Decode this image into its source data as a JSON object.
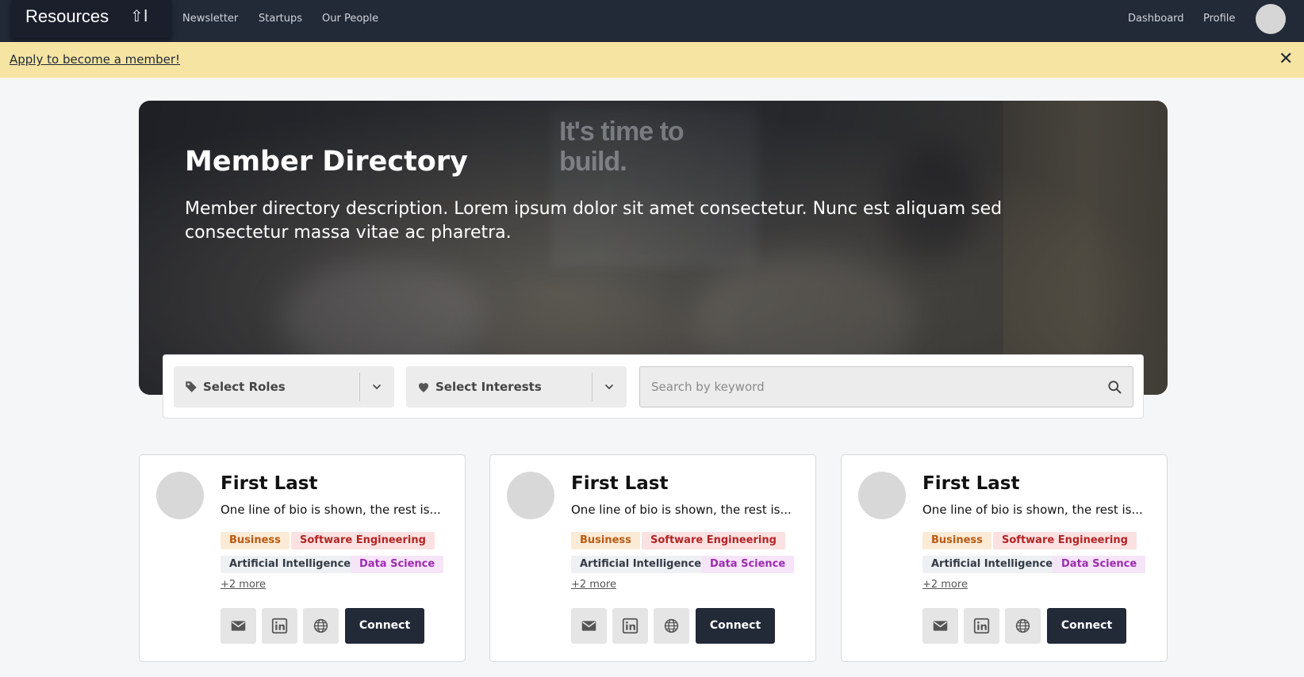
{
  "nav": {
    "brand": "Resources",
    "brand_glyph": "⇧I",
    "links": [
      "Newsletter",
      "Startups",
      "Our People"
    ],
    "right_links": [
      "Dashboard",
      "Profile"
    ]
  },
  "banner": {
    "text": "Apply to become a member!",
    "close": "✕",
    "color": "#f6e4a3"
  },
  "hero": {
    "title": "Member Directory",
    "description": "Member directory description. Lorem ipsum dolor sit amet consectetur. Nunc est aliquam sed consectetur massa vitae ac pharetra.",
    "sign_text": "It's time to build."
  },
  "filters": {
    "roles_label": "Select Roles",
    "interests_label": "Select Interests",
    "search_placeholder": "Search by keyword"
  },
  "cards": [
    {
      "name": "First Last",
      "bio": "One line of bio is shown, the rest is...",
      "tags": [
        "Business",
        "Software Engineering",
        "Artificial Intelligence",
        "Data Science"
      ],
      "more": "+2 more",
      "connect": "Connect"
    },
    {
      "name": "First Last",
      "bio": "One line of bio is shown, the rest is...",
      "tags": [
        "Business",
        "Software Engineering",
        "Artificial Intelligence",
        "Data Science"
      ],
      "more": "+2 more",
      "connect": "Connect"
    },
    {
      "name": "First Last",
      "bio": "One line of bio is shown, the rest is...",
      "tags": [
        "Business",
        "Software Engineering",
        "Artificial Intelligence",
        "Data Science"
      ],
      "more": "+2 more",
      "connect": "Connect"
    }
  ],
  "colors": {
    "nav_bg": "#222937",
    "page_bg": "#f5f6f8",
    "connect_bg": "#222937",
    "tag_business": "#b85a12",
    "tag_software": "#b42323",
    "tag_ai": "#333a44",
    "tag_data": "#9c2cb0"
  }
}
